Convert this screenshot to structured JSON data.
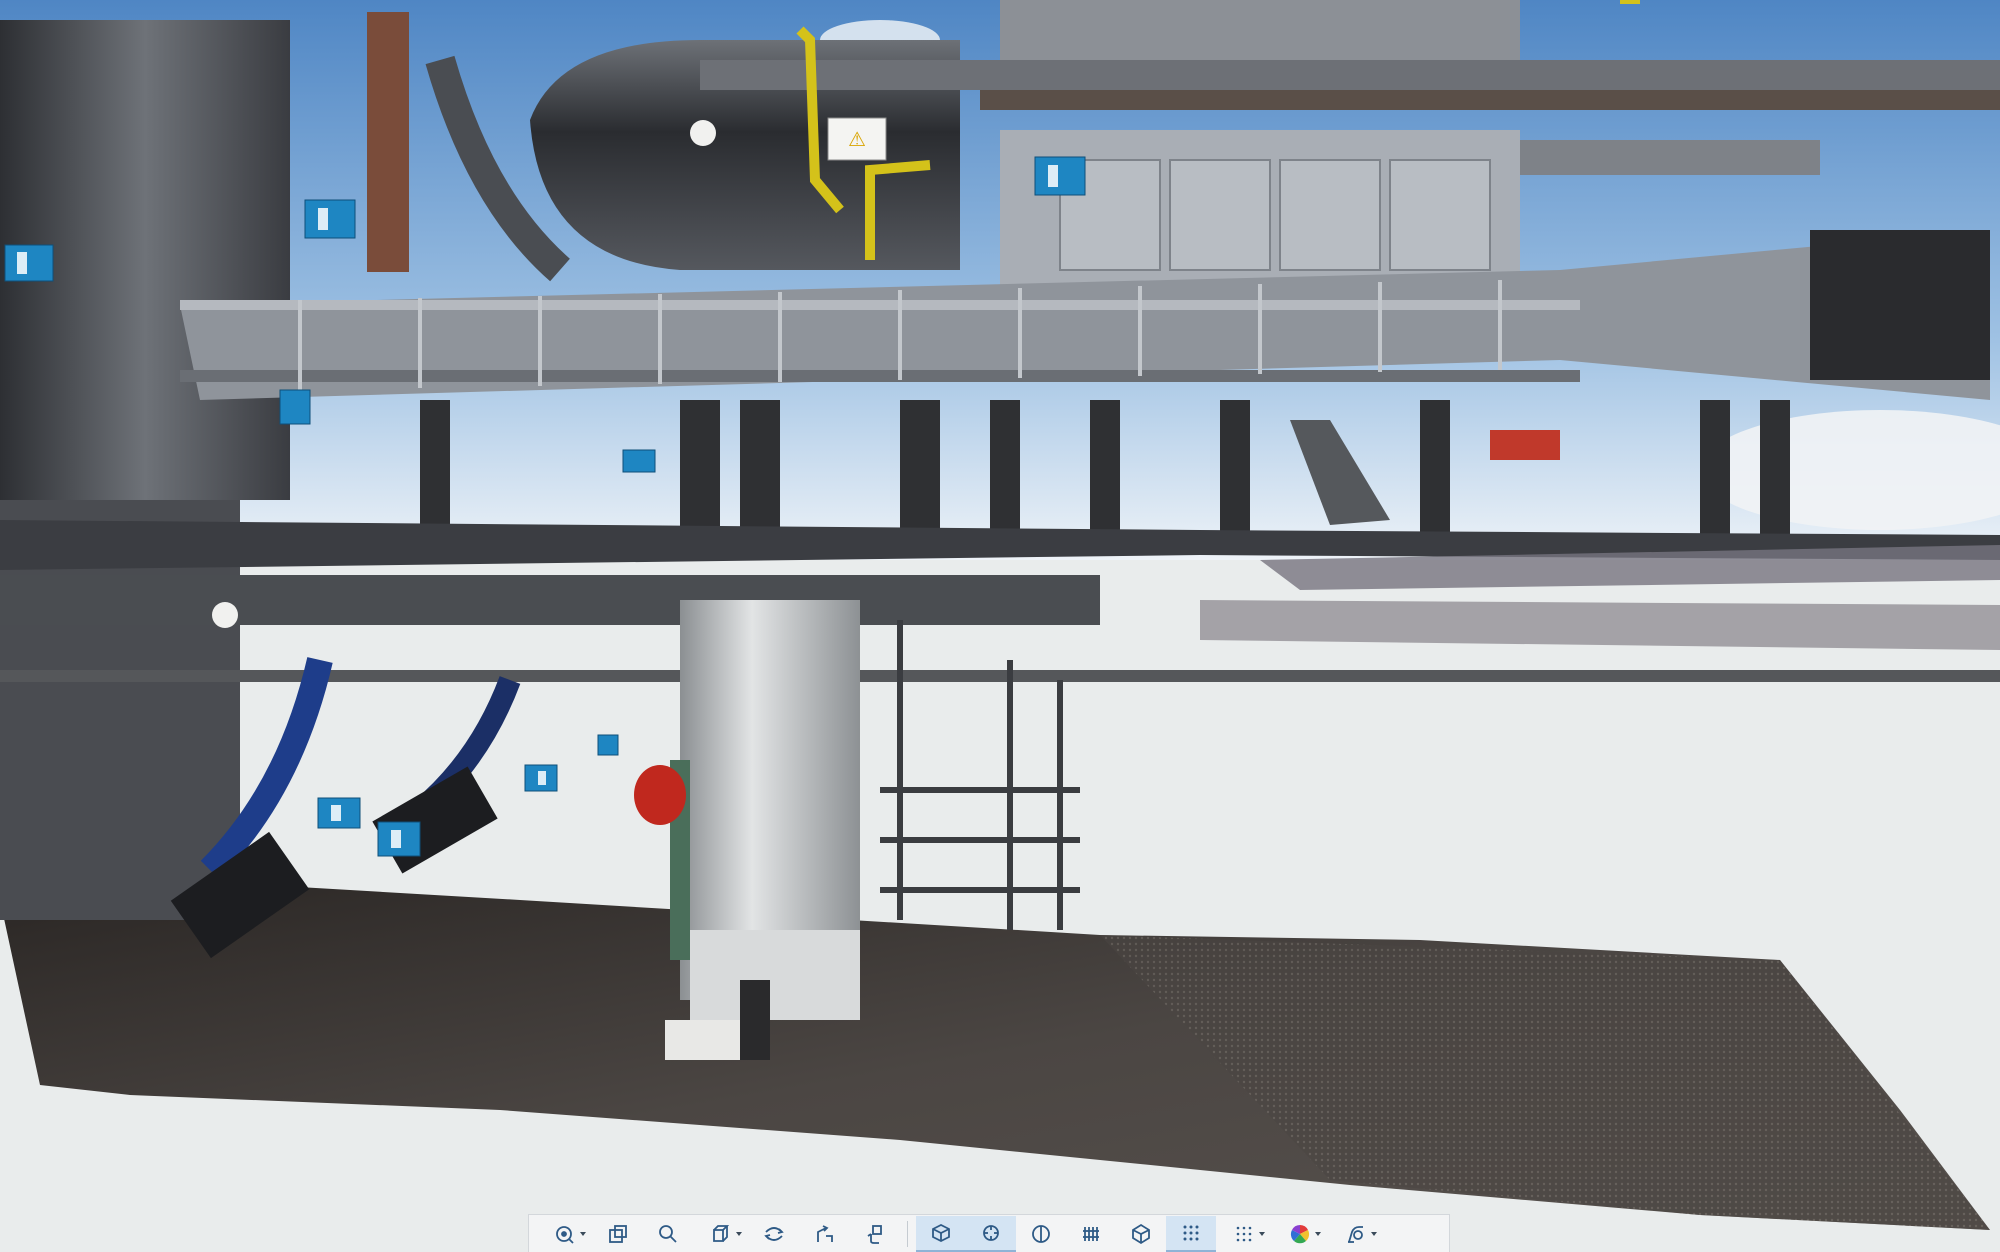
{
  "viewer": {
    "scene": "point-cloud-scan",
    "sign_symbol": "⚠",
    "colors": {
      "sky": "#5a8fc7",
      "background": "#e9ecec",
      "floor": "#3b3735",
      "steel": "#9aa0a8",
      "target_blue": "#1e86c2",
      "toolbar_bg": "#f3f4f5",
      "toolbar_active": "#d4e4f3",
      "icon": "#2e5a86"
    }
  },
  "toolbar": {
    "buttons": [
      {
        "icon": "orbit-icon",
        "dropdown": true
      },
      {
        "icon": "fit-view-icon",
        "dropdown": false
      },
      {
        "icon": "zoom-icon",
        "dropdown": false
      },
      {
        "icon": "view-cube-icon",
        "dropdown": true
      },
      {
        "icon": "rotate-icon",
        "dropdown": false
      },
      {
        "icon": "walk-icon",
        "dropdown": false
      },
      {
        "icon": "pan-icon",
        "dropdown": false
      },
      {
        "icon": "scan-box-icon",
        "dropdown": false,
        "active": true
      },
      {
        "icon": "lasso-icon",
        "dropdown": false,
        "active": true
      },
      {
        "icon": "section-icon",
        "dropdown": false
      },
      {
        "icon": "clip-plane-icon",
        "dropdown": false
      },
      {
        "icon": "hexagon-icon",
        "dropdown": false
      },
      {
        "icon": "points-grid-icon",
        "dropdown": false,
        "active": true
      },
      {
        "icon": "point-density-icon",
        "dropdown": true
      },
      {
        "icon": "color-mode-icon",
        "dropdown": true
      },
      {
        "icon": "lighting-icon",
        "dropdown": true
      }
    ]
  }
}
